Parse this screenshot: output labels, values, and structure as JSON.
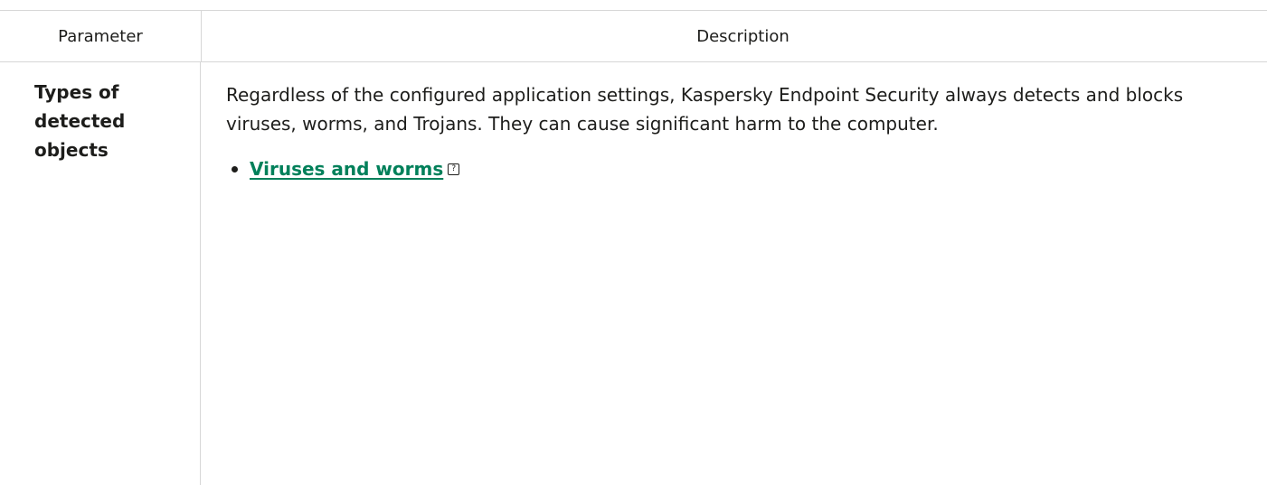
{
  "table": {
    "headers": {
      "parameter": "Parameter",
      "description": "Description"
    },
    "rows": [
      {
        "parameter": "Types of detected objects",
        "description": "Regardless of the configured application settings, Kaspersky Endpoint Security always detects and blocks viruses, worms, and Trojans. They can cause significant harm to the computer.",
        "bullets": [
          {
            "label": "Viruses and worms",
            "help_icon": "?"
          }
        ]
      }
    ]
  },
  "colors": {
    "link": "#00805a",
    "text": "#1d1d1b",
    "border": "#d7d7d7"
  },
  "icons": {
    "help": "help-icon"
  }
}
